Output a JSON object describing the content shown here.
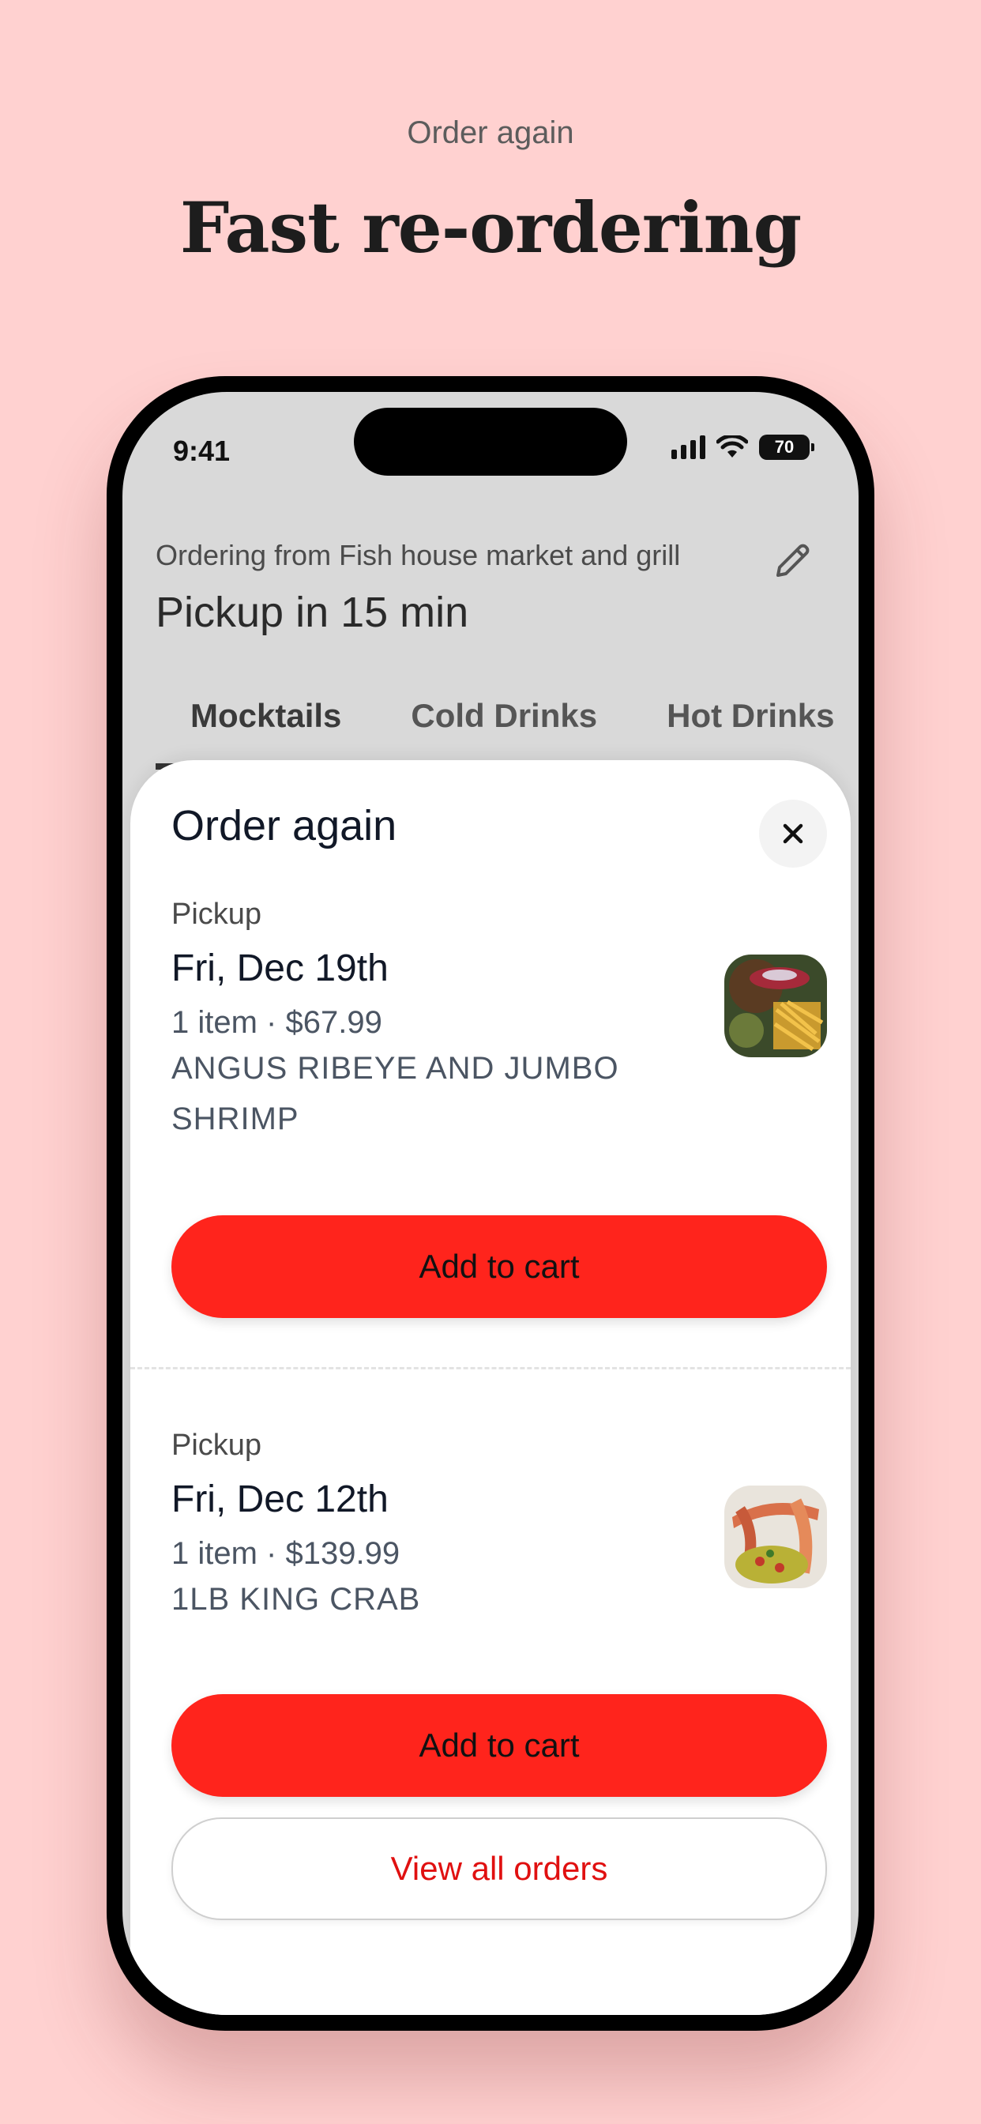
{
  "promo": {
    "eyebrow": "Order again",
    "headline": "Fast re-ordering"
  },
  "status_bar": {
    "time": "9:41",
    "battery": "70",
    "icons": [
      "signal-icon",
      "wifi-icon",
      "battery-icon"
    ]
  },
  "header": {
    "ordering_from": "Ordering from Fish house market and grill",
    "pickup_time": "Pickup in 15 min",
    "edit_icon": "pencil-icon"
  },
  "tabs": [
    {
      "label": "Mocktails",
      "active": true
    },
    {
      "label": "Cold Drinks",
      "active": false
    },
    {
      "label": "Hot Drinks",
      "active": false
    }
  ],
  "sheet": {
    "title": "Order again",
    "close_icon": "close-icon",
    "orders": [
      {
        "type": "Pickup",
        "date": "Fri, Dec 19th",
        "meta": "1 item · $67.99",
        "items": "ANGUS RIBEYE AND JUMBO SHRIMP",
        "add_label": "Add to cart"
      },
      {
        "type": "Pickup",
        "date": "Fri, Dec 12th",
        "meta": "1 item · $139.99",
        "items": "1LB KING CRAB",
        "add_label": "Add to cart"
      }
    ],
    "view_all_label": "View all orders"
  },
  "colors": {
    "background": "#FFD1D0",
    "accent": "#FF241C",
    "link": "#E01010"
  }
}
